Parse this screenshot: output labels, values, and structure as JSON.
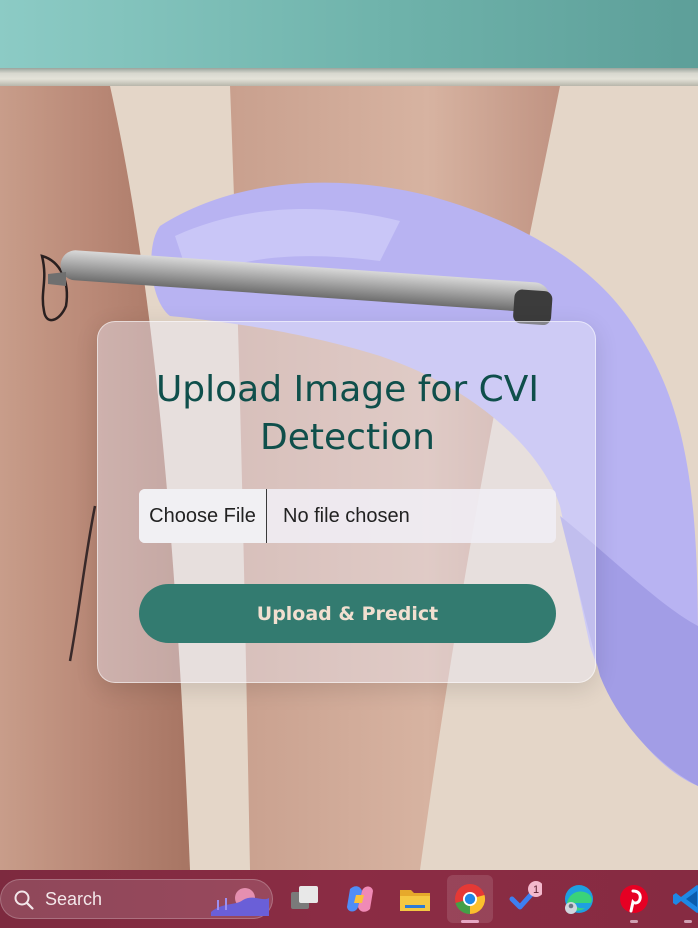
{
  "form": {
    "title": "Upload Image for CVI Detection",
    "choose_file_label": "Choose File",
    "file_status": "No file chosen",
    "submit_label": "Upload & Predict"
  },
  "taskbar": {
    "search_label": "Search",
    "apps": [
      {
        "name": "task-view",
        "icon": "task-view-icon"
      },
      {
        "name": "copilot",
        "icon": "copilot-icon"
      },
      {
        "name": "file-explorer",
        "icon": "folder-icon"
      },
      {
        "name": "chrome",
        "icon": "chrome-icon",
        "active": true
      },
      {
        "name": "todo",
        "icon": "checkmark-icon",
        "badge": "1"
      },
      {
        "name": "edge",
        "icon": "edge-icon"
      },
      {
        "name": "pinterest",
        "icon": "pinterest-icon"
      },
      {
        "name": "vscode",
        "icon": "vscode-icon"
      }
    ]
  },
  "colors": {
    "accent": "#337b70",
    "title": "#0f4f4b",
    "taskbar": "#8b2c44",
    "header": "#6fb3ab"
  }
}
